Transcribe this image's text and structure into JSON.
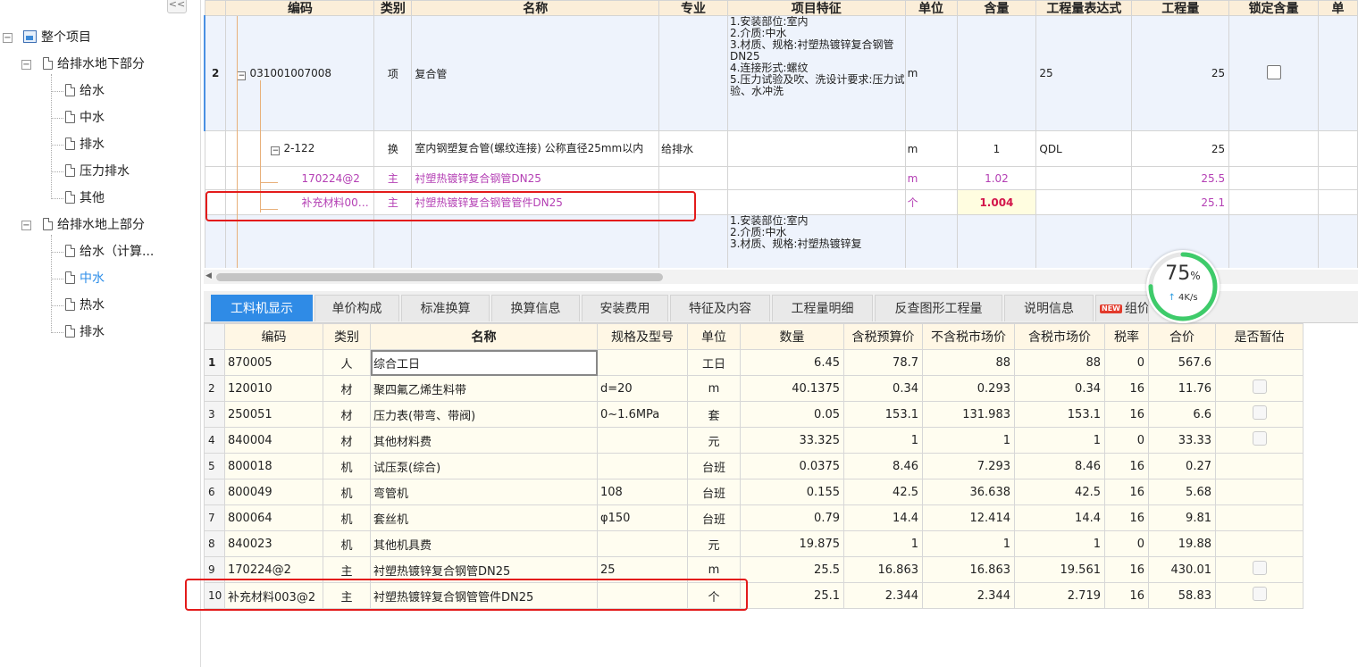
{
  "tree": {
    "collapse": "<<",
    "root": "整个项目",
    "group1": {
      "label": "给排水地下部分",
      "items": [
        "给水",
        "中水",
        "排水",
        "压力排水",
        "其他"
      ]
    },
    "group2": {
      "label": "给排水地上部分",
      "items": [
        "给水（计算...",
        "中水",
        "热水",
        "排水"
      ]
    },
    "selected": "中水"
  },
  "upper": {
    "headers": [
      "编码",
      "类别",
      "名称",
      "专业",
      "项目特征",
      "单位",
      "含量",
      "工程量表达式",
      "工程量",
      "锁定含量",
      "单"
    ],
    "row1": {
      "num": "2",
      "code": "031001007008",
      "type": "项",
      "name": "复合管",
      "major": "",
      "feature": "1.安装部位:室内\n2.介质:中水\n3.材质、规格:衬塑热镀锌复合钢管 DN25\n4.连接形式:螺纹\n5.压力试验及吹、洗设计要求:压力试验、水冲洗",
      "unit": "m",
      "content": "",
      "expr": "25",
      "qty": "25"
    },
    "row2": {
      "code": "2-122",
      "type": "换",
      "name": "室内钢塑复合管(螺纹连接) 公称直径25mm以内",
      "major": "给排水",
      "unit": "m",
      "content": "1",
      "expr": "QDL",
      "qty": "25"
    },
    "row3": {
      "code": "170224@2",
      "type": "主",
      "name": "衬塑热镀锌复合钢管DN25",
      "unit": "m",
      "content": "1.02",
      "qty": "25.5"
    },
    "row4": {
      "code": "补充材料00…",
      "type": "主",
      "name": "衬塑热镀锌复合钢管管件DN25",
      "unit": "个",
      "content": "1.004",
      "qty": "25.1"
    },
    "row5": {
      "feature": "1.安装部位:室内\n2.介质:中水\n3.材质、规格:衬塑热镀锌复"
    }
  },
  "tabs": [
    "工料机显示",
    "单价构成",
    "标准换算",
    "换算信息",
    "安装费用",
    "特征及内容",
    "工程量明细",
    "反查图形工程量",
    "说明信息",
    "组价方"
  ],
  "new_badge": "NEW",
  "lower": {
    "headers": [
      "编码",
      "类别",
      "名称",
      "规格及型号",
      "单位",
      "数量",
      "含税预算价",
      "不含税市场价",
      "含税市场价",
      "税率",
      "合价",
      "是否暂估"
    ],
    "rows": [
      {
        "idx": "1",
        "code": "870005",
        "type": "人",
        "name": "综合工日",
        "spec": "",
        "unit": "工日",
        "qty": "6.45",
        "p1": "78.7",
        "p2": "88",
        "p3": "88",
        "tax": "0",
        "total": "567.6",
        "chk": false
      },
      {
        "idx": "2",
        "code": "120010",
        "type": "材",
        "name": "聚四氟乙烯生料带",
        "spec": "d=20",
        "unit": "m",
        "qty": "40.1375",
        "p1": "0.34",
        "p2": "0.293",
        "p3": "0.34",
        "tax": "16",
        "total": "11.76",
        "chk": true
      },
      {
        "idx": "3",
        "code": "250051",
        "type": "材",
        "name": "压力表(带弯、带阀)",
        "spec": "0~1.6MPa",
        "unit": "套",
        "qty": "0.05",
        "p1": "153.1",
        "p2": "131.983",
        "p3": "153.1",
        "tax": "16",
        "total": "6.6",
        "chk": true
      },
      {
        "idx": "4",
        "code": "840004",
        "type": "材",
        "name": "其他材料费",
        "spec": "",
        "unit": "元",
        "qty": "33.325",
        "p1": "1",
        "p2": "1",
        "p3": "1",
        "tax": "0",
        "total": "33.33",
        "chk": true
      },
      {
        "idx": "5",
        "code": "800018",
        "type": "机",
        "name": "试压泵(综合)",
        "spec": "",
        "unit": "台班",
        "qty": "0.0375",
        "p1": "8.46",
        "p2": "7.293",
        "p3": "8.46",
        "tax": "16",
        "total": "0.27",
        "chk": false
      },
      {
        "idx": "6",
        "code": "800049",
        "type": "机",
        "name": "弯管机",
        "spec": "108",
        "unit": "台班",
        "qty": "0.155",
        "p1": "42.5",
        "p2": "36.638",
        "p3": "42.5",
        "tax": "16",
        "total": "5.68",
        "chk": false
      },
      {
        "idx": "7",
        "code": "800064",
        "type": "机",
        "name": "套丝机",
        "spec": "φ150",
        "unit": "台班",
        "qty": "0.79",
        "p1": "14.4",
        "p2": "12.414",
        "p3": "14.4",
        "tax": "16",
        "total": "9.81",
        "chk": false
      },
      {
        "idx": "8",
        "code": "840023",
        "type": "机",
        "name": "其他机具费",
        "spec": "",
        "unit": "元",
        "qty": "19.875",
        "p1": "1",
        "p2": "1",
        "p3": "1",
        "tax": "0",
        "total": "19.88",
        "chk": false
      },
      {
        "idx": "9",
        "code": "170224@2",
        "type": "主",
        "name": "衬塑热镀锌复合钢管DN25",
        "spec": "25",
        "unit": "m",
        "qty": "25.5",
        "p1": "16.863",
        "p2": "16.863",
        "p3": "19.561",
        "tax": "16",
        "total": "430.01",
        "chk": true
      },
      {
        "idx": "10",
        "code": "补充材料003@2",
        "type": "主",
        "name": "衬塑热镀锌复合钢管管件DN25",
        "spec": "",
        "unit": "个",
        "qty": "25.1",
        "p1": "2.344",
        "p2": "2.344",
        "p3": "2.719",
        "tax": "16",
        "total": "58.83",
        "chk": true
      }
    ]
  },
  "speed": {
    "percent": "75",
    "percent_sign": "%",
    "rate": "4K/s",
    "progress": 0.75
  },
  "colors": {
    "accent": "#2f8be6",
    "highlight": "#e31b1b",
    "magenta": "#b43fb4",
    "gauge": "#3ecb6a"
  }
}
